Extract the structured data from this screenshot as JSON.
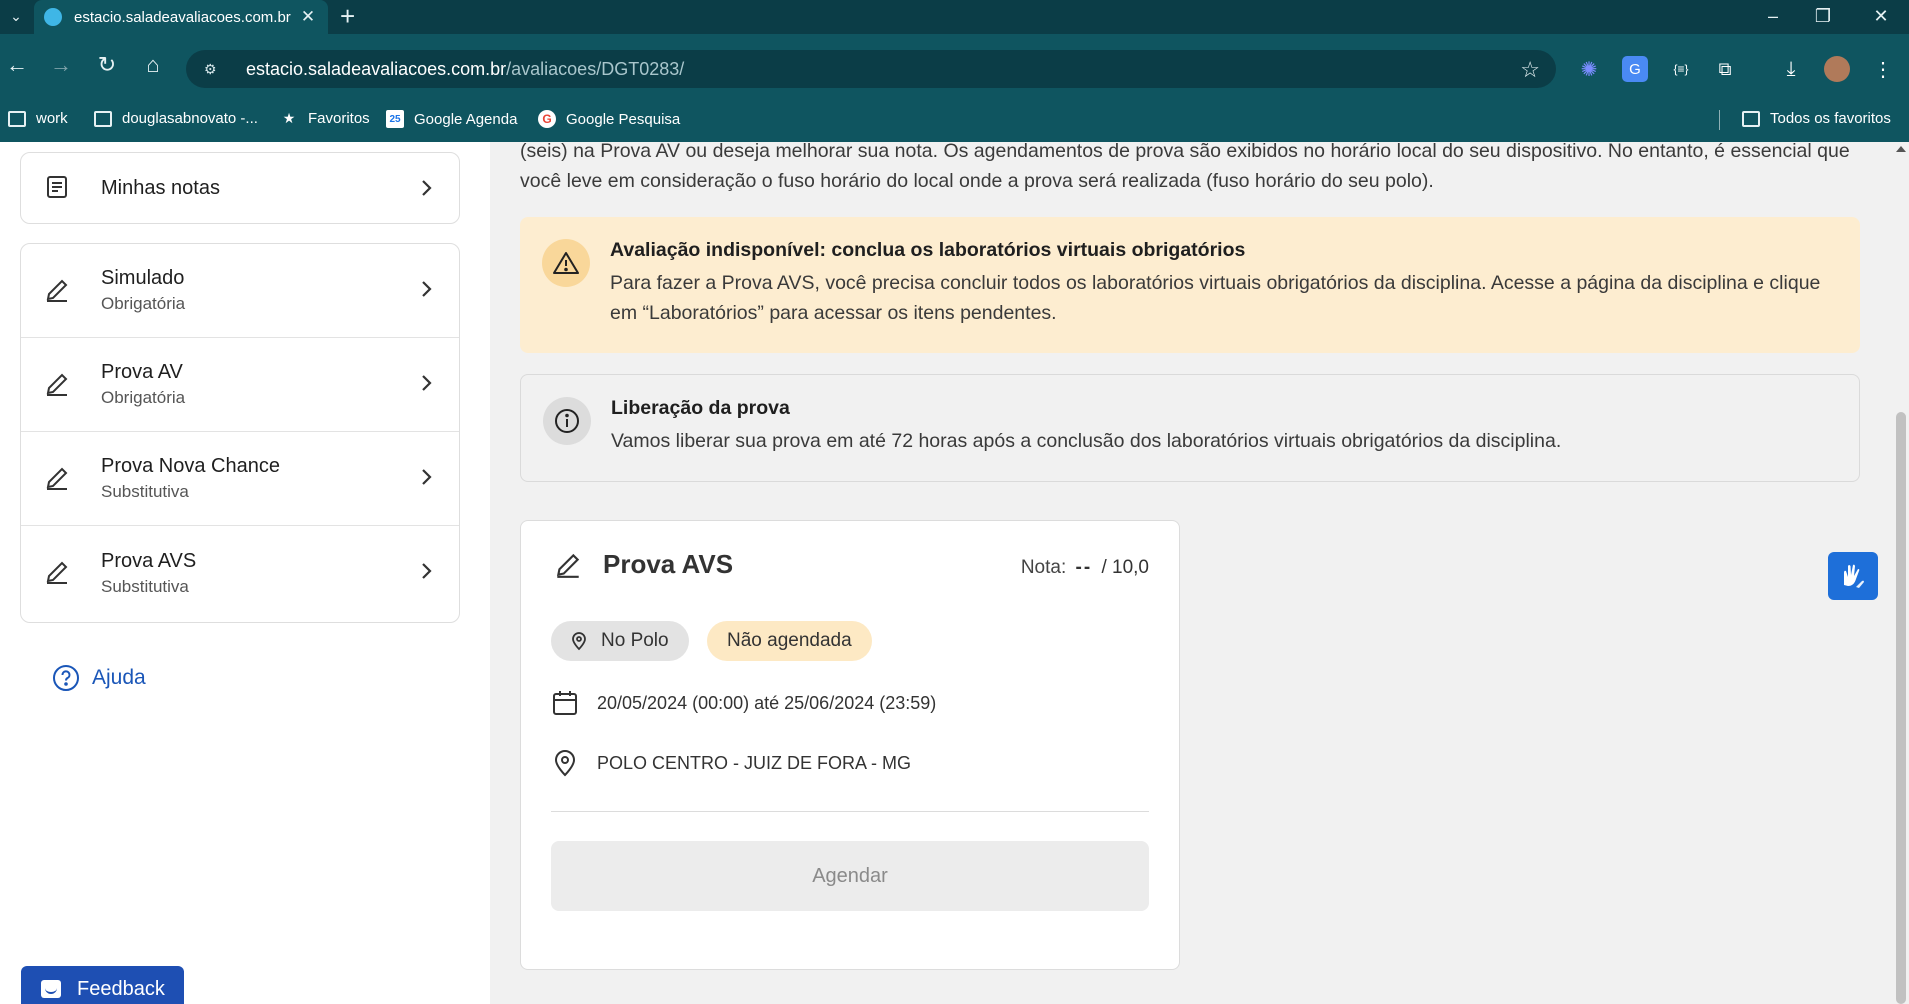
{
  "browser": {
    "tab_title": "estacio.saladeavaliacoes.com.br",
    "url_host": "estacio.saladeavaliacoes.com.br",
    "url_path": "/avaliacoes/DGT0283/",
    "bookmarks": [
      "work",
      "douglasabnovato -...",
      "Favoritos",
      "Google Agenda",
      "Google Pesquisa"
    ],
    "all_bookmarks": "Todos os favoritos",
    "gcal_badge": "25",
    "gsearch_badge": "G"
  },
  "sidebar": {
    "notes_label": "Minhas notas",
    "items": [
      {
        "label": "Simulado",
        "sub": "Obrigatória"
      },
      {
        "label": "Prova AV",
        "sub": "Obrigatória"
      },
      {
        "label": "Prova Nova Chance",
        "sub": "Substitutiva"
      },
      {
        "label": "Prova AVS",
        "sub": "Substitutiva"
      }
    ],
    "help_label": "Ajuda",
    "feedback_label": "Feedback"
  },
  "main": {
    "intro_text": "(seis) na Prova AV ou deseja melhorar sua nota. Os agendamentos de prova são exibidos no horário local do seu dispositivo. No entanto, é essencial que você leve em consideração o fuso horário do local onde a prova será realizada (fuso horário do seu polo).",
    "warning": {
      "title": "Avaliação indisponível: conclua os laboratórios virtuais obrigatórios",
      "body": "Para fazer a Prova AVS, você precisa concluir todos os laboratórios virtuais obrigatórios da disciplina. Acesse a página da disciplina e clique em “Laboratórios” para acessar os itens pendentes."
    },
    "info": {
      "title": "Liberação da prova",
      "body": "Vamos liberar sua prova em até 72 horas após a conclusão dos laboratórios virtuais obrigatórios da disciplina."
    },
    "exam": {
      "title": "Prova AVS",
      "grade_label": "Nota:",
      "grade_value": "--",
      "grade_max": "/ 10,0",
      "location_chip": "No Polo",
      "status_chip": "Não agendada",
      "period": "20/05/2024 (00:00) até 25/06/2024 (23:59)",
      "polo": "POLO CENTRO - JUIZ DE FORA - MG",
      "schedule_button": "Agendar"
    }
  },
  "colors": {
    "chrome_dark": "#0b3d47",
    "chrome": "#0f5560",
    "warning_bg": "#fdedd0",
    "link_blue": "#1a56b8",
    "feedback_blue": "#1e4fb3"
  }
}
